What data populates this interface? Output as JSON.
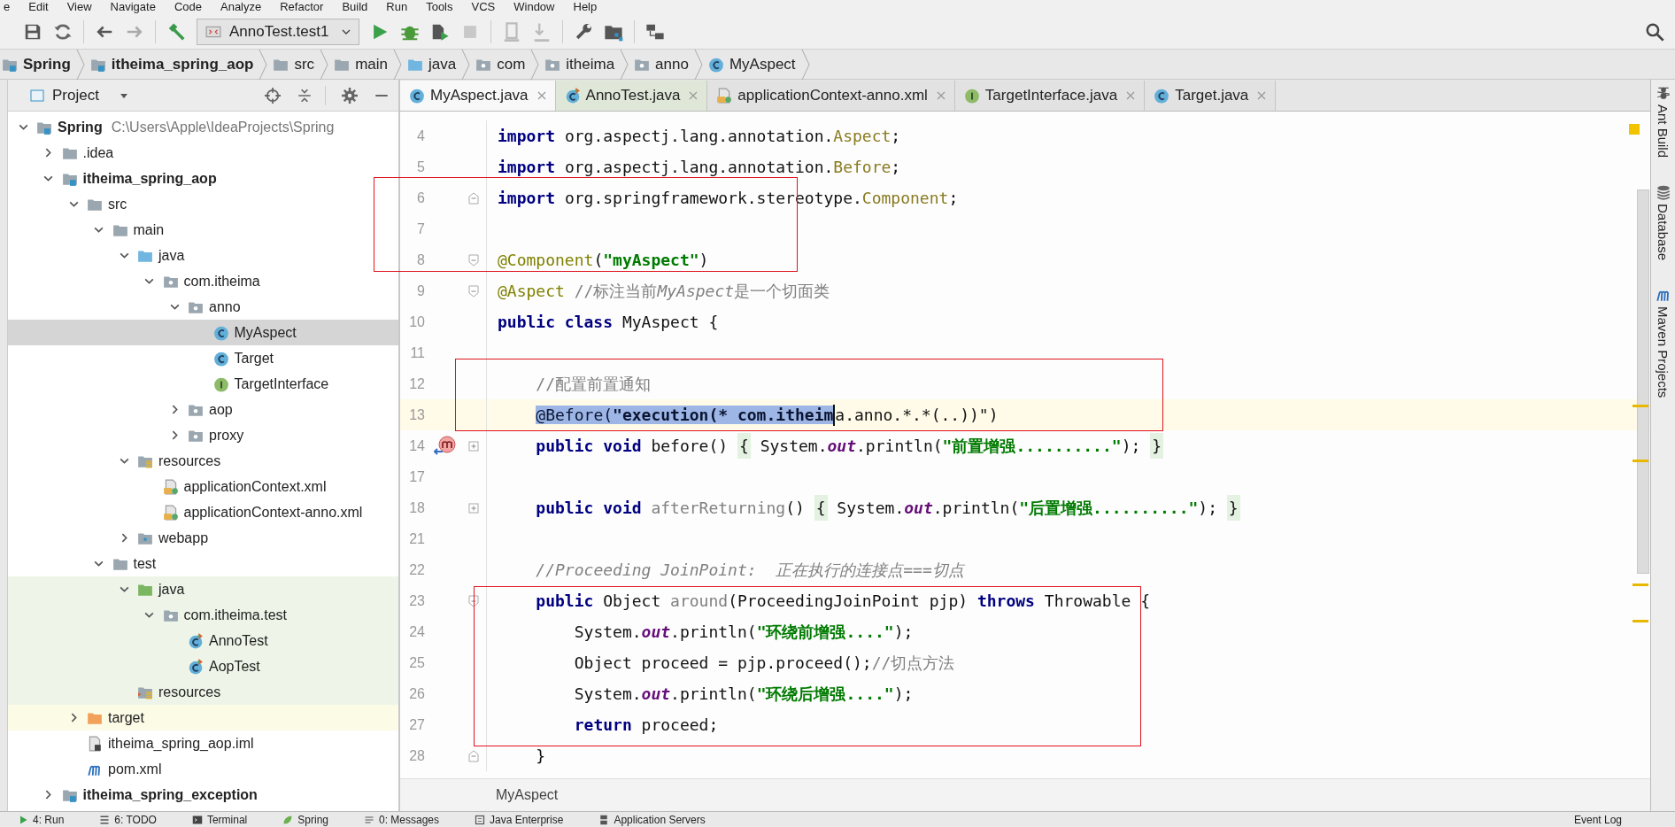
{
  "menu": [
    "e",
    "Edit",
    "View",
    "Navigate",
    "Code",
    "Analyze",
    "Refactor",
    "Build",
    "Run",
    "Tools",
    "VCS",
    "Window",
    "Help"
  ],
  "toolbar": {
    "run_config": "AnnoTest.test1"
  },
  "breadcrumbs": [
    {
      "label": "Spring",
      "kind": "module"
    },
    {
      "label": "itheima_spring_aop",
      "kind": "module"
    },
    {
      "label": "src",
      "kind": "folder"
    },
    {
      "label": "main",
      "kind": "folder"
    },
    {
      "label": "java",
      "kind": "source-folder"
    },
    {
      "label": "com",
      "kind": "package"
    },
    {
      "label": "itheima",
      "kind": "package"
    },
    {
      "label": "anno",
      "kind": "package"
    },
    {
      "label": "MyAspect",
      "kind": "class"
    }
  ],
  "project": {
    "title": "Project",
    "tree": [
      {
        "label": "Spring",
        "kind": "module",
        "bold": true,
        "hint": "C:\\Users\\Apple\\IdeaProjects\\Spring",
        "expanded": true,
        "selected": false,
        "children": [
          {
            "label": ".idea",
            "kind": "folder",
            "expanded": false,
            "selected": false
          },
          {
            "label": "itheima_spring_aop",
            "kind": "module",
            "bold": true,
            "expanded": true,
            "selected": false,
            "children": [
              {
                "label": "src",
                "kind": "folder",
                "expanded": true,
                "selected": false,
                "children": [
                  {
                    "label": "main",
                    "kind": "folder",
                    "expanded": true,
                    "selected": false,
                    "children": [
                      {
                        "label": "java",
                        "kind": "source-folder",
                        "expanded": true,
                        "selected": false,
                        "children": [
                          {
                            "label": "com.itheima",
                            "kind": "package",
                            "expanded": true,
                            "selected": false,
                            "children": [
                              {
                                "label": "anno",
                                "kind": "package",
                                "expanded": true,
                                "selected": false,
                                "children": [
                                  {
                                    "label": "MyAspect",
                                    "kind": "class",
                                    "selected": true
                                  },
                                  {
                                    "label": "Target",
                                    "kind": "class",
                                    "selected": false
                                  },
                                  {
                                    "label": "TargetInterface",
                                    "kind": "interface",
                                    "selected": false
                                  }
                                ]
                              },
                              {
                                "label": "aop",
                                "kind": "package",
                                "expanded": false,
                                "selected": false
                              },
                              {
                                "label": "proxy",
                                "kind": "package",
                                "expanded": false,
                                "selected": false
                              }
                            ]
                          }
                        ]
                      },
                      {
                        "label": "resources",
                        "kind": "resources",
                        "expanded": true,
                        "selected": false,
                        "children": [
                          {
                            "label": "applicationContext.xml",
                            "kind": "xml",
                            "selected": false
                          },
                          {
                            "label": "applicationContext-anno.xml",
                            "kind": "xml",
                            "selected": false
                          }
                        ]
                      },
                      {
                        "label": "webapp",
                        "kind": "web",
                        "expanded": false,
                        "selected": false
                      }
                    ]
                  },
                  {
                    "label": "test",
                    "kind": "folder",
                    "expanded": true,
                    "selected": false,
                    "children": [
                      {
                        "label": "java",
                        "kind": "test-folder",
                        "test": true,
                        "expanded": true,
                        "selected": false,
                        "children": [
                          {
                            "label": "com.itheima.test",
                            "kind": "package",
                            "test": true,
                            "expanded": true,
                            "selected": false,
                            "children": [
                              {
                                "label": "AnnoTest",
                                "kind": "test-class",
                                "test": true,
                                "selected": false
                              },
                              {
                                "label": "AopTest",
                                "kind": "test-class",
                                "test": true,
                                "selected": false
                              }
                            ]
                          }
                        ]
                      },
                      {
                        "label": "resources",
                        "kind": "test-resources",
                        "test": true,
                        "selected": false
                      }
                    ]
                  }
                ]
              },
              {
                "label": "target",
                "kind": "excluded",
                "excluded": true,
                "expanded": false,
                "selected": false
              },
              {
                "label": "itheima_spring_aop.iml",
                "kind": "iml",
                "selected": false
              },
              {
                "label": "pom.xml",
                "kind": "maven",
                "selected": false
              }
            ]
          },
          {
            "label": "itheima_spring_exception",
            "kind": "module",
            "bold": true,
            "expanded": false,
            "selected": false
          }
        ]
      }
    ]
  },
  "tabs": [
    {
      "label": "MyAspect.java",
      "kind": "class",
      "selected": true
    },
    {
      "label": "AnnoTest.java",
      "kind": "test-class",
      "selected": false
    },
    {
      "label": "applicationContext-anno.xml",
      "kind": "xml",
      "selected": false
    },
    {
      "label": "TargetInterface.java",
      "kind": "interface",
      "selected": false
    },
    {
      "label": "Target.java",
      "kind": "class",
      "selected": false
    }
  ],
  "code": [
    {
      "number": "4",
      "tokens": [
        {
          "text": "import",
          "kind": "keyword"
        },
        {
          "text": " org.aspectj.lang.annotation.",
          "kind": "plain"
        },
        {
          "text": "Aspect",
          "kind": "type"
        },
        {
          "text": ";",
          "kind": "plain"
        }
      ]
    },
    {
      "number": "5",
      "tokens": [
        {
          "text": "import",
          "kind": "keyword"
        },
        {
          "text": " org.aspectj.lang.annotation.",
          "kind": "plain"
        },
        {
          "text": "Before",
          "kind": "type"
        },
        {
          "text": ";",
          "kind": "plain"
        }
      ]
    },
    {
      "number": "6",
      "fold": {
        "kind": "end"
      },
      "tokens": [
        {
          "text": "import",
          "kind": "keyword"
        },
        {
          "text": " org.springframework.stereotype.",
          "kind": "plain"
        },
        {
          "text": "Component",
          "kind": "type"
        },
        {
          "text": ";",
          "kind": "plain"
        }
      ]
    },
    {
      "number": "7"
    },
    {
      "number": "8",
      "fold": {
        "kind": "start"
      },
      "tokens": [
        {
          "text": "@Component",
          "kind": "annotation"
        },
        {
          "text": "(",
          "kind": "plain"
        },
        {
          "text": "\"myAspect\"",
          "kind": "string"
        },
        {
          "text": ")",
          "kind": "plain"
        }
      ]
    },
    {
      "number": "9",
      "fold": {
        "kind": "start"
      },
      "tokens": [
        {
          "text": "@Aspect",
          "kind": "annotation"
        },
        {
          "text": " //标注当前",
          "kind": "comment"
        },
        {
          "text": "MyAspect",
          "kind": "comment-italic"
        },
        {
          "text": "是一个切面类",
          "kind": "comment"
        }
      ]
    },
    {
      "number": "10",
      "tokens": [
        {
          "text": "public class",
          "kind": "keyword"
        },
        {
          "text": " MyAspect {",
          "kind": "plain"
        }
      ]
    },
    {
      "number": "11"
    },
    {
      "number": "12",
      "tokens": [
        {
          "text": "    //配置前置通知",
          "kind": "comment"
        }
      ]
    },
    {
      "number": "13",
      "current": true,
      "tokens": [
        {
          "text": "    @Before(",
          "kind": "annotation",
          "selected": true
        },
        {
          "text": "\"execution(* com.itheim",
          "kind": "string",
          "selected": true
        },
        {
          "text": "a.anno.*.*(..))\"",
          "kind": "plain",
          "selected": false
        },
        {
          "text": ")",
          "kind": "plain",
          "selected": false
        }
      ]
    },
    {
      "number": "14",
      "fold": {
        "kind": "collapsed"
      },
      "gutter": {
        "kind": "override"
      },
      "tokens": [
        {
          "text": "    public void",
          "kind": "keyword"
        },
        {
          "text": " before() ",
          "kind": "plain"
        },
        {
          "text": "{",
          "kind": "folded"
        },
        {
          "text": " System.",
          "kind": "plain"
        },
        {
          "text": "out",
          "kind": "field"
        },
        {
          "text": ".println(",
          "kind": "plain"
        },
        {
          "text": "\"前置增强..........\"",
          "kind": "string"
        },
        {
          "text": "); ",
          "kind": "plain"
        },
        {
          "text": "}",
          "kind": "folded"
        }
      ]
    },
    {
      "number": "17"
    },
    {
      "number": "18",
      "fold": {
        "kind": "collapsed"
      },
      "tokens": [
        {
          "text": "    public void",
          "kind": "keyword"
        },
        {
          "text": " afterReturning",
          "kind": "unused"
        },
        {
          "text": "() ",
          "kind": "plain"
        },
        {
          "text": "{",
          "kind": "folded"
        },
        {
          "text": " System.",
          "kind": "plain"
        },
        {
          "text": "out",
          "kind": "field"
        },
        {
          "text": ".println(",
          "kind": "plain"
        },
        {
          "text": "\"后置增强..........\"",
          "kind": "string"
        },
        {
          "text": "); ",
          "kind": "plain"
        },
        {
          "text": "}",
          "kind": "folded"
        }
      ]
    },
    {
      "number": "21"
    },
    {
      "number": "22",
      "tokens": [
        {
          "text": "    //Proceeding JoinPoint:  正在执行的连接点===切点",
          "kind": "comment-italic"
        }
      ]
    },
    {
      "number": "23",
      "fold": {
        "kind": "start"
      },
      "tokens": [
        {
          "text": "    public",
          "kind": "keyword"
        },
        {
          "text": " Object ",
          "kind": "plain"
        },
        {
          "text": "around",
          "kind": "unused"
        },
        {
          "text": "(ProceedingJoinPoint pjp) ",
          "kind": "plain"
        },
        {
          "text": "throws",
          "kind": "keyword"
        },
        {
          "text": " Throwable {",
          "kind": "plain"
        }
      ]
    },
    {
      "number": "24",
      "tokens": [
        {
          "text": "        System.",
          "kind": "plain"
        },
        {
          "text": "out",
          "kind": "field"
        },
        {
          "text": ".println(",
          "kind": "plain"
        },
        {
          "text": "\"环绕前增强....\"",
          "kind": "string"
        },
        {
          "text": ");",
          "kind": "plain"
        }
      ]
    },
    {
      "number": "25",
      "tokens": [
        {
          "text": "        Object proceed = pjp.proceed();",
          "kind": "plain"
        },
        {
          "text": "//切点方法",
          "kind": "comment"
        }
      ]
    },
    {
      "number": "26",
      "tokens": [
        {
          "text": "        System.",
          "kind": "plain"
        },
        {
          "text": "out",
          "kind": "field"
        },
        {
          "text": ".println(",
          "kind": "plain"
        },
        {
          "text": "\"环绕后增强....\"",
          "kind": "string"
        },
        {
          "text": ");",
          "kind": "plain"
        }
      ]
    },
    {
      "number": "27",
      "tokens": [
        {
          "text": "        return",
          "kind": "keyword"
        },
        {
          "text": " proceed;",
          "kind": "plain"
        }
      ]
    },
    {
      "number": "28",
      "fold": {
        "kind": "end"
      },
      "tokens": [
        {
          "text": "    }",
          "kind": "plain"
        }
      ]
    }
  ],
  "editor_breadcrumb": "MyAspect",
  "right_tools": [
    {
      "label": "Ant Build",
      "kind": "ant"
    },
    {
      "label": "Database",
      "kind": "database"
    },
    {
      "label": "Maven Projects",
      "kind": "maven"
    }
  ],
  "bottom_tools": [
    {
      "label": "4: Run",
      "kind": "run"
    },
    {
      "label": "6: TODO",
      "kind": "todo"
    },
    {
      "label": "Terminal",
      "kind": "terminal"
    },
    {
      "label": "Spring",
      "kind": "spring"
    },
    {
      "label": "0: Messages",
      "kind": "messages"
    },
    {
      "label": "Java Enterprise",
      "kind": "enterprise"
    },
    {
      "label": "Application Servers",
      "kind": "servers"
    }
  ],
  "event_log": "Event Log"
}
